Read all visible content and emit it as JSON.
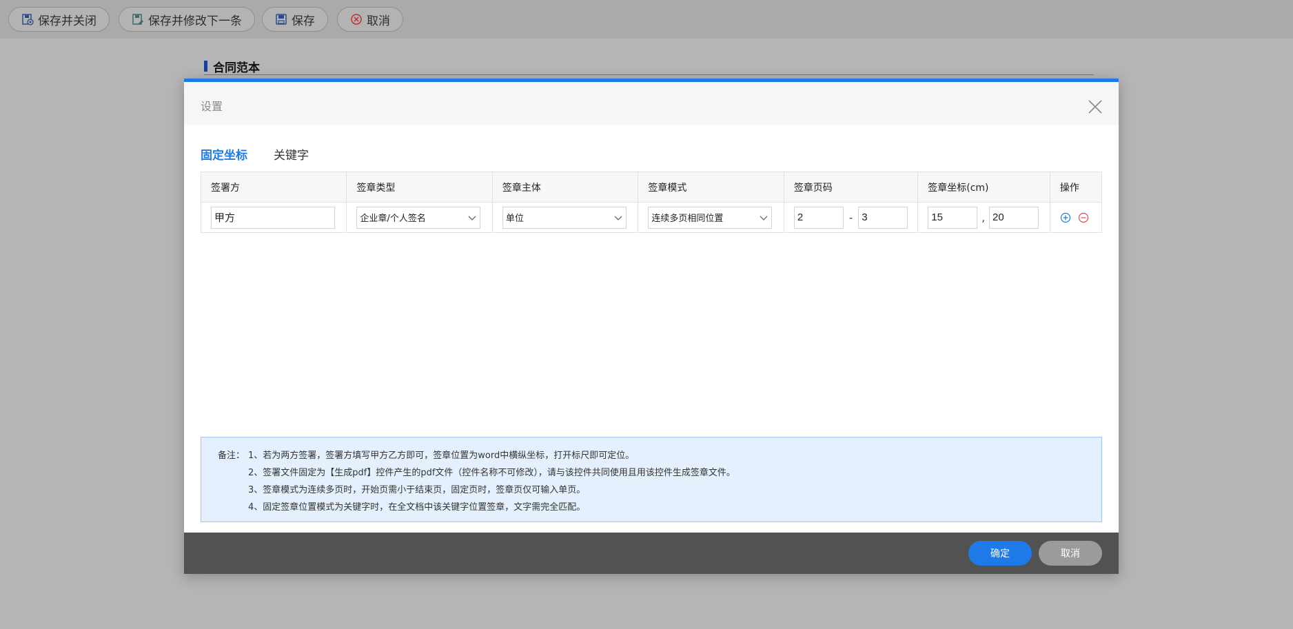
{
  "toolbar": {
    "save_close": "保存并关闭",
    "save_edit_next": "保存并修改下一条",
    "save": "保存",
    "cancel": "取消"
  },
  "page": {
    "title": "合同范本"
  },
  "modal": {
    "title": "设置",
    "tabs": [
      {
        "label": "固定坐标",
        "active": true
      },
      {
        "label": "关键字",
        "active": false
      }
    ],
    "table": {
      "headers": [
        "签署方",
        "签章类型",
        "签章主体",
        "签章模式",
        "签章页码",
        "签章坐标(cm)",
        "操作"
      ],
      "rows": [
        {
          "signer": "甲方",
          "seal_type": "企业章/个人签名",
          "seal_subject": "单位",
          "seal_mode": "连续多页相同位置",
          "page_from": "2",
          "page_sep": "-",
          "page_to": "3",
          "coord_x": "15",
          "coord_sep": ",",
          "coord_y": "20"
        }
      ]
    },
    "notes": {
      "label": "备注：",
      "lines": [
        "1、若为两方签署，签署方填写甲方乙方即可，签章位置为word中横纵坐标，打开标尺即可定位。",
        "2、签署文件固定为【生成pdf】控件产生的pdf文件（控件名称不可修改），请与该控件共同使用且用该控件生成签章文件。",
        "3、签章模式为连续多页时，开始页需小于结束页，固定页时，签章页仅可输入单页。",
        "4、固定签章位置模式为关键字时，在全文档中该关键字位置签章，文字需完全匹配。"
      ]
    },
    "footer": {
      "ok": "确定",
      "cancel": "取消"
    }
  },
  "colors": {
    "accent": "#1e7ae8",
    "remove": "#e04848",
    "overlay": "#b5b5b5"
  },
  "icons": [
    "save-close-icon",
    "save-edit-icon",
    "save-icon",
    "cancel-icon",
    "close-icon",
    "chevron-down-icon",
    "add-circle-icon",
    "remove-circle-icon"
  ]
}
